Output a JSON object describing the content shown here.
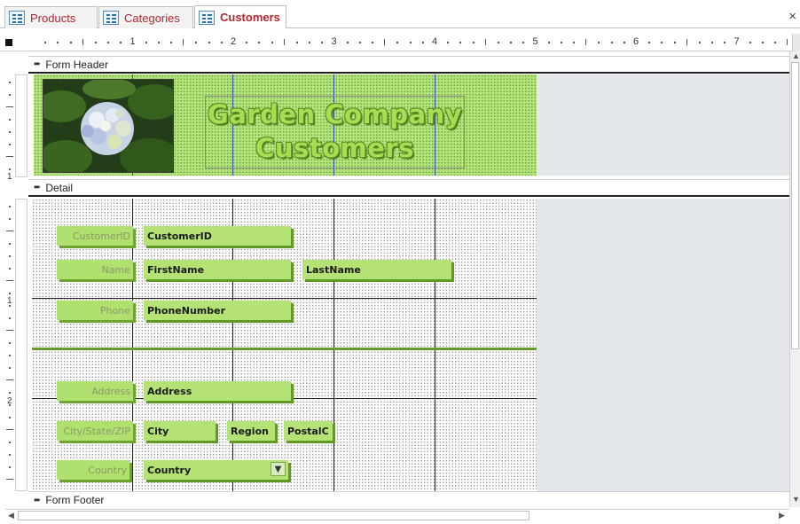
{
  "tabs": [
    {
      "label": "Products",
      "active": false
    },
    {
      "label": "Categories",
      "active": false
    },
    {
      "label": "Customers",
      "active": true
    }
  ],
  "close_glyph": "×",
  "ruler": {
    "numbers": [
      "1",
      "2",
      "3",
      "4",
      "5",
      "6",
      "7"
    ]
  },
  "vertical_ruler": {
    "header_numbers": [
      "1"
    ],
    "detail_numbers": [
      "1",
      "2"
    ]
  },
  "sections": {
    "form_header": "Form Header",
    "detail": "Detail",
    "form_footer": "Form Footer"
  },
  "header": {
    "title_line1": "Garden Company",
    "title_line2": "Customers",
    "image": "hydrangea-photo"
  },
  "fields": {
    "customer_id": {
      "label": "CustomerID",
      "control": "CustomerID"
    },
    "name": {
      "label": "Name",
      "first": "FirstName",
      "last": "LastName"
    },
    "phone": {
      "label": "Phone",
      "control": "PhoneNumber"
    },
    "address": {
      "label": "Address",
      "control": "Address"
    },
    "city_state_zip": {
      "label": "City/State/ZIP",
      "city": "City",
      "region": "Region",
      "postal": "PostalC"
    },
    "country": {
      "label": "Country",
      "control": "Country"
    }
  },
  "colors": {
    "tab_text": "#b3262c",
    "header_fill": "#b2e27a",
    "control_fill": "#b0e06d",
    "control_shadow": "#6da530",
    "title_text": "#a8dc55",
    "canvas_background": "#e4e7ec"
  },
  "icons": {
    "tab": "form-icon",
    "section": "section-arrow-icon",
    "combo": "chevron-down-icon"
  }
}
